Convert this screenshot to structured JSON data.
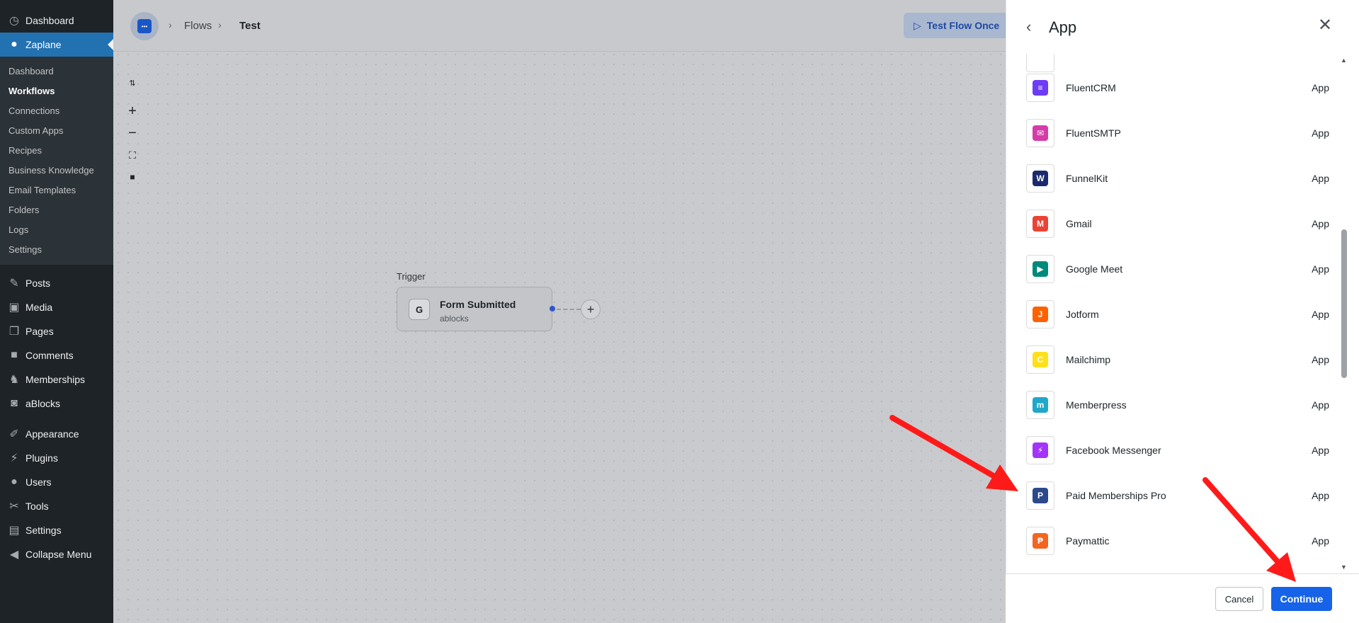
{
  "sidebar": {
    "top_items": [
      {
        "label": "Dashboard",
        "icon": "dashboard-icon"
      },
      {
        "label": "Zaplane",
        "icon": "zaplane-icon"
      }
    ],
    "submenu": [
      "Dashboard",
      "Workflows",
      "Connections",
      "Custom Apps",
      "Recipes",
      "Business Knowledge",
      "Email Templates",
      "Folders",
      "Logs",
      "Settings"
    ],
    "items": [
      {
        "label": "Posts",
        "icon": "pin-icon"
      },
      {
        "label": "Media",
        "icon": "media-icon"
      },
      {
        "label": "Pages",
        "icon": "pages-icon"
      },
      {
        "label": "Comments",
        "icon": "comment-icon"
      },
      {
        "label": "Memberships",
        "icon": "memberships-icon"
      },
      {
        "label": "aBlocks",
        "icon": "ablocks-icon"
      },
      {
        "label": "Appearance",
        "icon": "brush-icon"
      },
      {
        "label": "Plugins",
        "icon": "plug-icon"
      },
      {
        "label": "Users",
        "icon": "user-icon"
      },
      {
        "label": "Tools",
        "icon": "wrench-icon"
      },
      {
        "label": "Settings",
        "icon": "settings-icon"
      },
      {
        "label": "Collapse Menu",
        "icon": "collapse-icon"
      }
    ]
  },
  "topbar": {
    "breadcrumb": [
      "Flows",
      "Test"
    ],
    "test_button": "Test Flow Once"
  },
  "canvas": {
    "trigger_label": "Trigger",
    "node_title": "Form Submitted",
    "node_subtitle": "ablocks"
  },
  "drawer": {
    "title": "App",
    "apps": [
      {
        "name": "FluentCRM",
        "type": "App",
        "color": "#6d3cf5",
        "glyph": "≡"
      },
      {
        "name": "FluentSMTP",
        "type": "App",
        "color": "#d63ca8",
        "glyph": "✉"
      },
      {
        "name": "FunnelKit",
        "type": "App",
        "color": "#1a2a6c",
        "glyph": "W"
      },
      {
        "name": "Gmail",
        "type": "App",
        "color": "#ea4335",
        "glyph": "M"
      },
      {
        "name": "Google Meet",
        "type": "App",
        "color": "#00897b",
        "glyph": "▶"
      },
      {
        "name": "Jotform",
        "type": "App",
        "color": "#ff6100",
        "glyph": "J"
      },
      {
        "name": "Mailchimp",
        "type": "App",
        "color": "#ffe01b",
        "glyph": "C"
      },
      {
        "name": "Memberpress",
        "type": "App",
        "color": "#1fa8c9",
        "glyph": "m"
      },
      {
        "name": "Facebook Messenger",
        "type": "App",
        "color": "#a334fa",
        "glyph": "⚡"
      },
      {
        "name": "Paid Memberships Pro",
        "type": "App",
        "color": "#2c4a8a",
        "glyph": "P"
      },
      {
        "name": "Paymattic",
        "type": "App",
        "color": "#f26522",
        "glyph": "₱"
      }
    ],
    "cancel_label": "Cancel",
    "continue_label": "Continue"
  }
}
